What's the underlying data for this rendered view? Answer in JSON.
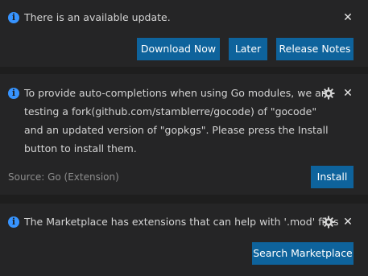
{
  "notifications": [
    {
      "message_lines": [
        "There is an available update."
      ],
      "buttons": {
        "download_now": "Download Now",
        "later": "Later",
        "release_notes": "Release Notes"
      },
      "close_glyph": "✕"
    },
    {
      "message_lines": [
        "To provide auto-completions when using Go modules, we are",
        "testing a fork(github.com/stamblerre/gocode) of \"gocode\"",
        "and an updated version of \"gopkgs\". Please press the Install",
        "button to install them."
      ],
      "source": "Source: Go (Extension)",
      "buttons": {
        "install": "Install"
      },
      "close_glyph": "✕"
    },
    {
      "message_lines": [
        "The Marketplace has extensions that can help with '.mod' files"
      ],
      "buttons": {
        "search_marketplace": "Search Marketplace"
      },
      "close_glyph": "✕"
    }
  ],
  "icons": {
    "info": "info-icon",
    "gear": "gear-icon",
    "close": "close-icon"
  },
  "colors": {
    "background": "#1e1e1e",
    "toast_background": "#252526",
    "button": "#0e639c",
    "info_icon": "#3794ff",
    "text": "#d4d4d4",
    "source_text": "#8d8d8d"
  }
}
